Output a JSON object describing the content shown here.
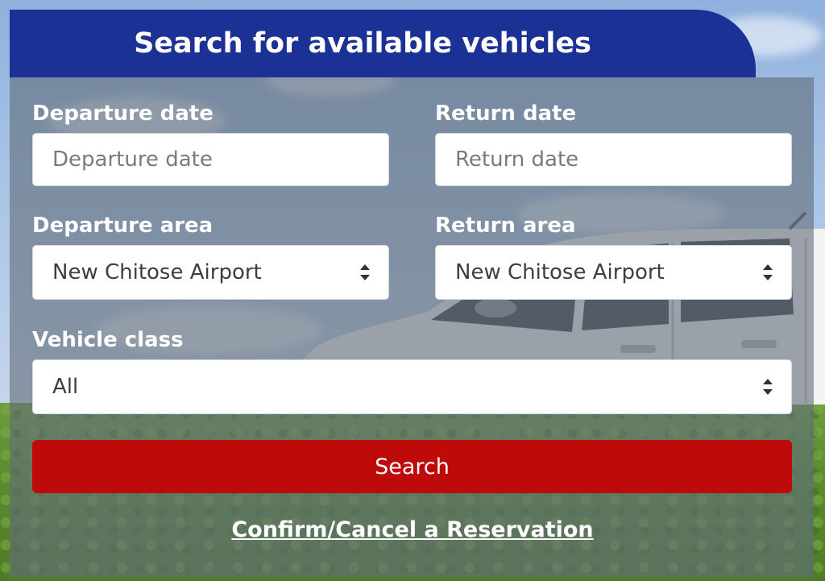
{
  "header": {
    "title": "Search for available vehicles"
  },
  "form": {
    "departure_date": {
      "label": "Departure date",
      "placeholder": "Departure date",
      "value": ""
    },
    "return_date": {
      "label": "Return date",
      "placeholder": "Return date",
      "value": ""
    },
    "departure_area": {
      "label": "Departure area",
      "selected": "New Chitose Airport"
    },
    "return_area": {
      "label": "Return area",
      "selected": "New Chitose Airport"
    },
    "vehicle_class": {
      "label": "Vehicle class",
      "selected": "All"
    },
    "search_label": "Search",
    "confirm_link": "Confirm/Cancel a Reservation"
  },
  "icons": {
    "select_arrow": "updown-chevron-icon"
  },
  "colors": {
    "header_bg": "#1b3196",
    "search_button": "#bf0a0a",
    "panel_overlay": "#626e7a"
  }
}
